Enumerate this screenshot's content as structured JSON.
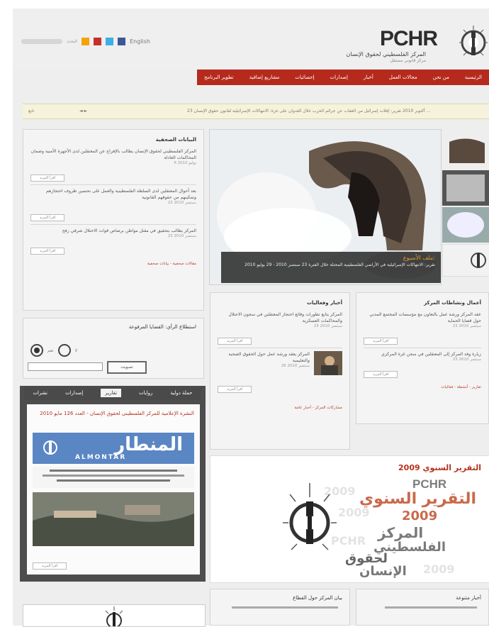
{
  "header": {
    "english_link": "English",
    "logo_title": "PCHR",
    "logo_subtitle": "المركز الفلسطيني لحقوق الإنسان",
    "logo_tagline": "مركز قانوني مستقل",
    "search_placeholder": "البحث"
  },
  "nav": {
    "items": [
      "الرئيسية",
      "من نحن",
      "مجالات العمل",
      "أخبار",
      "إصدارات",
      "إحصائيات",
      "مشاريع إضافية",
      "تطوير البرنامج"
    ]
  },
  "ticker": {
    "text": "تقرير: إفلات إسرائيل من العقاب عن جرائم الحرب خلال العدوان على غزة: الانتهاكات الإسرائيلية لقانون حقوق الإنسان ... ",
    "date": "23 أكتوبر 2010",
    "label": "تابع"
  },
  "left_news": {
    "title": "البيانات الصحفية",
    "items": [
      {
        "text": "المركز الفلسطيني لحقوق الإنسان يطالب بالإفراج عن المعتقلين لدى الأجهزة الأمنية وضمان المحاكمات العادلة",
        "date": "6 يوليو 2010"
      },
      {
        "text": "بعد أحوال المعتقلين لدى السلطة الفلسطينية والعمل على تحسين ظروف احتجازهم وتمكينهم من حقوقهم القانونية",
        "date": "23 سبتمبر 2010"
      },
      {
        "text": "المركز يطالب بتحقيق في مقتل مواطن برصاص قوات الاحتلال شرقي رفح",
        "date": "23 سبتمبر 2010"
      }
    ],
    "more_label": "اقرأ المزيد",
    "footer": "مقالات صحفية - بيانات صحفية"
  },
  "hero": {
    "headline": "ملف الأسبوع:",
    "caption": "تقرير: الانتهاكات الإسرائيلية في الأراضي الفلسطينية المحتلة خلال الفترة 23 سبتمبر 2010 - 29 يوليو 2010"
  },
  "poll": {
    "title": "استطلاع الرأي: القضايا المرفوعة",
    "option1": "نعم",
    "option2": "لا",
    "button": "تصويت"
  },
  "tabs": {
    "items": [
      "نشرات",
      "تقارير",
      "إصدارات",
      "روايات",
      "حملة دولية"
    ],
    "active_index": 1
  },
  "tab_content": {
    "headline": "النشرة الإعلامية للمركز الفلسطيني لحقوق الإنسان - العدد 126 مايو 2010",
    "magazine_name": "المنطار",
    "magazine_latin": "ALMONTAR",
    "more_label": "اقرأ المزيد"
  },
  "middle_news": {
    "title": "أخبار وفعاليات",
    "items": [
      {
        "text": "المركز يتابع تطورات وقائع احتجاز المعتقلين في سجون الاحتلال والمحاكمات العسكرية",
        "date": "23 سبتمبر 2010"
      },
      {
        "text": "المركز يعقد ورشة عمل حول الحقوق الصحية والتعليمية",
        "date": "26 سبتمبر 2010"
      }
    ],
    "more_label": "اقرأ المزيد",
    "footer": "مشاركات المركز - أخبار عامة"
  },
  "right_news": {
    "title": "أعمال ونشاطات المركز",
    "items": [
      {
        "text": "عقد المركز ورشة عمل بالتعاون مع مؤسسات المجتمع المدني حول قضايا الحماية",
        "date": "23 سبتمبر 2010"
      },
      {
        "text": "زيارة وفد المركز إلى المعتقلين في سجن غزة المركزي",
        "date": "23 سبتمبر 2010"
      }
    ],
    "more_label": "اقرأ المزيد",
    "footer": "تقارير - أنشطة - فعاليات"
  },
  "annual_report": {
    "title": "التقرير السنوي 2009",
    "pchr": "PCHR",
    "line1": "التقرير السنوي",
    "year": "2009",
    "line3": "المركز",
    "line4": "الفلسطيني",
    "line5": "لحقوق",
    "line6": "الإنسان"
  },
  "bottom": {
    "left_title": "بيان المركز حول القطاع",
    "right_title": "أخبار متنوعة"
  },
  "colors": {
    "nav_red": "#b52a1c",
    "tab_dark": "#4a4a4a",
    "accent_red": "#b4321f",
    "ticker_bg": "#f6f3dc"
  }
}
